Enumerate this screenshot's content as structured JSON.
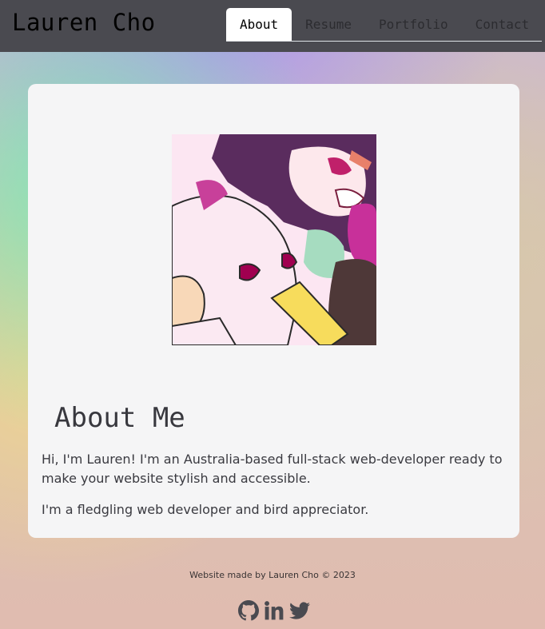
{
  "header": {
    "brand": "Lauren Cho",
    "tabs": [
      {
        "label": "About",
        "active": true
      },
      {
        "label": "Resume",
        "active": false
      },
      {
        "label": "Portfolio",
        "active": false
      },
      {
        "label": "Contact",
        "active": false
      }
    ]
  },
  "main": {
    "image": {
      "icon": "anime-characters-illustration"
    },
    "title": "About Me",
    "paragraphs": [
      "Hi, I'm Lauren! I'm an Australia-based full-stack web-developer ready to make your website stylish and accessible.",
      "I'm a fledgling web developer and bird appreciator."
    ]
  },
  "footer": {
    "credit": "Website made by Lauren Cho © 2023",
    "socials": [
      {
        "icon": "github-icon"
      },
      {
        "icon": "linkedin-icon"
      },
      {
        "icon": "twitter-icon"
      }
    ]
  },
  "colors": {
    "header_bg": "#4a4a50",
    "card_bg": "#f5f5f6",
    "text": "#3a3a40",
    "icon": "#4a4a50"
  }
}
